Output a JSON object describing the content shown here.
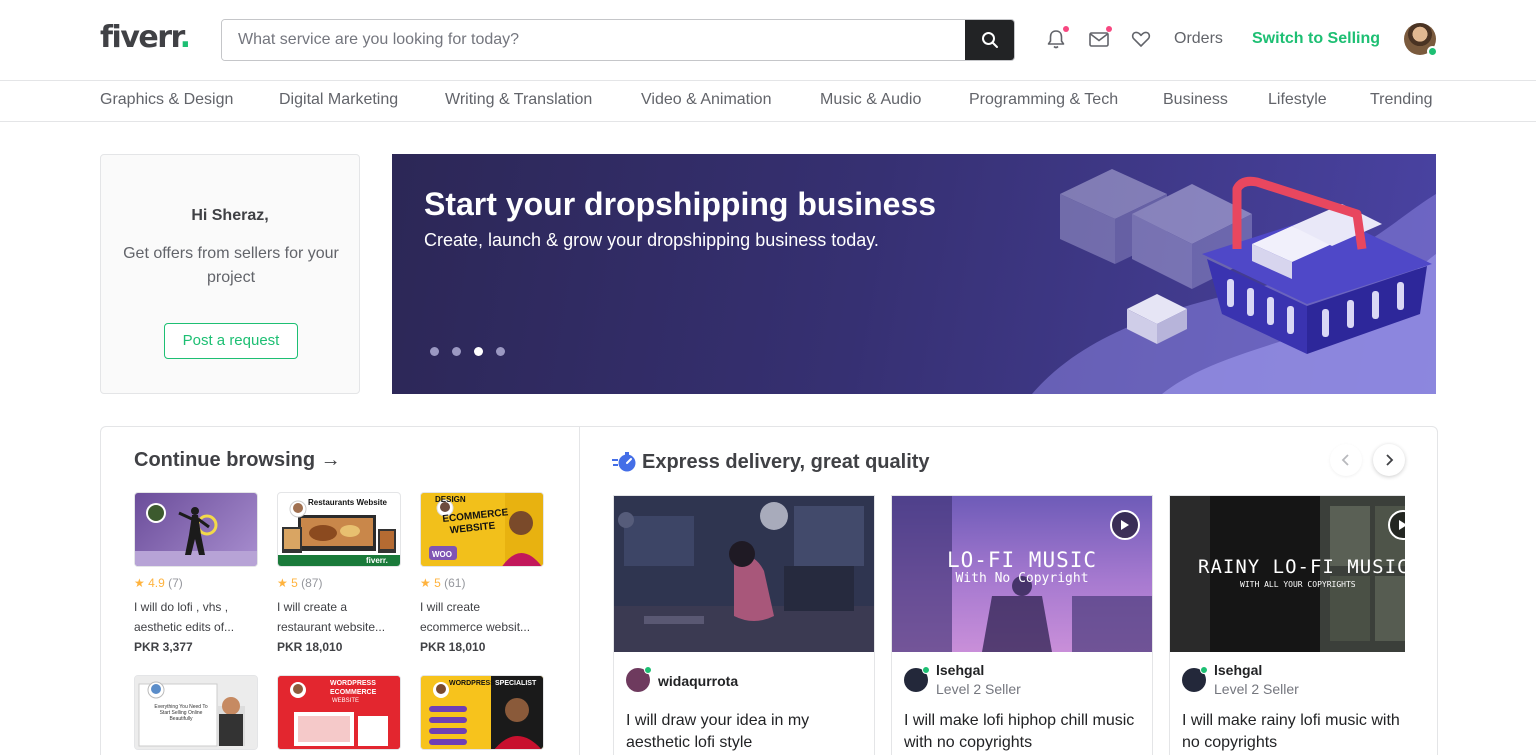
{
  "header": {
    "logo_text": "fiverr",
    "logo_dot": ".",
    "search_placeholder": "What service are you looking for today?",
    "orders_label": "Orders",
    "switch_label": "Switch to Selling",
    "accent_color": "#1dbf73"
  },
  "categories": [
    "Graphics & Design",
    "Digital Marketing",
    "Writing & Translation",
    "Video & Animation",
    "Music & Audio",
    "Programming & Tech",
    "Business",
    "Lifestyle",
    "Trending"
  ],
  "welcome": {
    "greeting": "Hi Sheraz,",
    "message": "Get offers from sellers for your project",
    "button": "Post a request"
  },
  "banner": {
    "title": "Start your dropshipping business",
    "subtitle": "Create, launch & grow your dropshipping business today.",
    "slide_count": 4,
    "active_slide": 3
  },
  "continue_browsing": {
    "title": "Continue browsing →",
    "items": [
      {
        "rating": "★ 4.9",
        "count": "(7)",
        "line1": "I will do lofi , vhs ,",
        "line2": "aesthetic edits of...",
        "price": "PKR 3,377"
      },
      {
        "rating": "★ 5",
        "count": "(87)",
        "line1": "I will create a",
        "line2": "restaurant website...",
        "price": "PKR 18,010",
        "thumb_text": "Restaurants Website",
        "thumb_brand": "fiverr."
      },
      {
        "rating": "★ 5",
        "count": "(61)",
        "line1": "I will create",
        "line2": "ecommerce websit...",
        "price": "PKR 18,010",
        "thumb_text1": "DESIGN",
        "thumb_text2": "ECOMMERCE WEBSITE",
        "thumb_text3": "WOO"
      },
      {
        "thumb_text": "Everything You Need To Start Selling Online Beautifully"
      },
      {
        "thumb_text1": "WORDPRESS",
        "thumb_text2": "ECOMMERCE",
        "thumb_text3": "WEBSITE"
      },
      {
        "thumb_text1": "WORDPRESS",
        "thumb_text2": "SPECIALIST"
      }
    ]
  },
  "express": {
    "title": "Express delivery, great quality",
    "cards": [
      {
        "seller": "widaqurrota",
        "level": "",
        "desc": "I will draw your idea in my aesthetic lofi style"
      },
      {
        "seller": "lsehgal",
        "level": "Level 2 Seller",
        "desc": "I will make lofi hiphop chill music with no copyrights",
        "thumb_title": "LO-FI MUSIC",
        "thumb_sub": "With No Copyright"
      },
      {
        "seller": "lsehgal",
        "level": "Level 2 Seller",
        "desc": "I will make rainy lofi music with no copyrights",
        "thumb_title": "RAINY LO-FI MUSIC",
        "thumb_sub": "WITH ALL YOUR COPYRIGHTS"
      }
    ]
  }
}
